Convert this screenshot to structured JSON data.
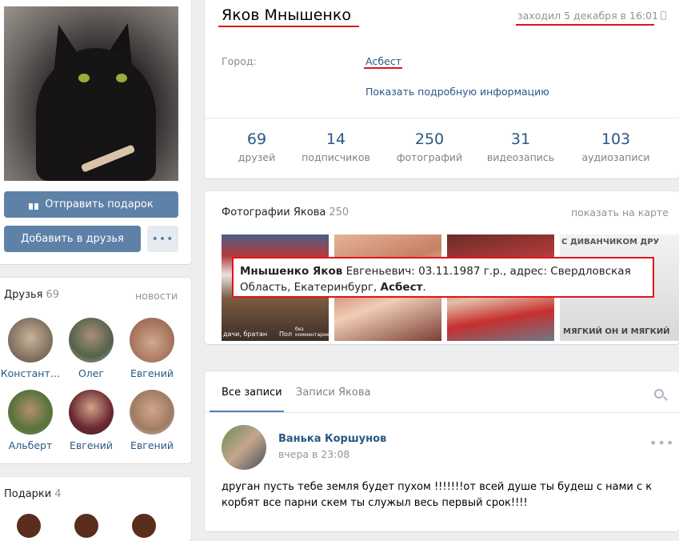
{
  "left": {
    "gift_button": "Отправить подарок",
    "add_friend_button": "Добавить в друзья",
    "more_button": "•••",
    "friends": {
      "title": "Друзья",
      "count": "69",
      "link": "новости",
      "items": [
        {
          "name": "Констант…"
        },
        {
          "name": "Олег"
        },
        {
          "name": "Евгений"
        },
        {
          "name": "Альберт"
        },
        {
          "name": "Евгений"
        },
        {
          "name": "Евгений"
        }
      ]
    },
    "gifts": {
      "title": "Подарки",
      "count": "4"
    }
  },
  "profile": {
    "name": "Яков Мнышенко",
    "last_seen": "заходил 5 декабря в 16:01",
    "city_label": "Город:",
    "city_value": "Асбест",
    "details_link": "Показать подробную информацию",
    "counters": [
      {
        "num": "69",
        "label": "друзей"
      },
      {
        "num": "14",
        "label": "подписчиков"
      },
      {
        "num": "250",
        "label": "фотографий"
      },
      {
        "num": "31",
        "label": "видеозапись"
      },
      {
        "num": "103",
        "label": "аудиозаписи"
      }
    ]
  },
  "photos": {
    "title": "Фотографии Якова",
    "count": "250",
    "map_link": "показать на карте",
    "thumb_captions": [
      "дачи, братан",
      "Пол",
      "без комментариев",
      "С ДИВАНЧИКОМ ДРУ",
      "МЯГКИЙ ОН И МЯГКИЙ"
    ],
    "popup": {
      "bold1": "Мнышенко Яков",
      "text1": " Евгеньевич: 03.11.1987 г.р., адрес: Свердловская Область, Екатеринбург, ",
      "bold2": "Асбест",
      "text2": "."
    }
  },
  "wall": {
    "tab_all": "Все записи",
    "tab_own": "Записи Якова",
    "post": {
      "author": "Ванька Коршунов",
      "time": "вчера в 23:08",
      "menu": "•••",
      "text": "друган пусть тебе земля будет пухом !!!!!!!от всей душе ты будеш с нами с к корбят все парни скем ты служыл весь первый срок!!!!"
    }
  },
  "colors": {
    "accent": "#5e81a8",
    "link": "#2a5885",
    "annotation": "#e0141c",
    "background": "#edeef0"
  }
}
